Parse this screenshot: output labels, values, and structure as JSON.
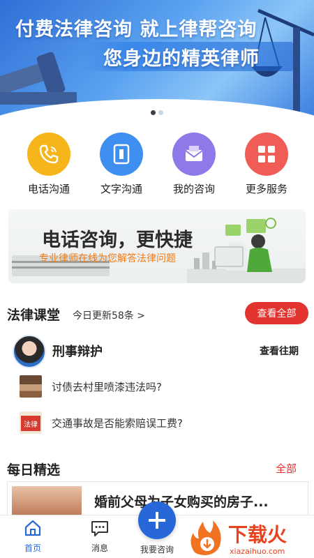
{
  "banner": {
    "line1": "付费法律咨询 就上律帮咨询",
    "line2": "您身边的精英律师",
    "dots_count": 2,
    "active_dot": 1
  },
  "actions": [
    {
      "label": "电话沟通",
      "icon": "phone-icon",
      "color": "#f7b51c"
    },
    {
      "label": "文字沟通",
      "icon": "text-chat-icon",
      "color": "#3f8ff0"
    },
    {
      "label": "我的咨询",
      "icon": "envelope-icon",
      "color": "#8f78e8"
    },
    {
      "label": "更多服务",
      "icon": "grid-icon",
      "color": "#f05c56"
    }
  ],
  "promo": {
    "title": "电话咨询，更快捷",
    "subtitle": "专业律师在线为您解答法律问题"
  },
  "classroom": {
    "title": "法律课堂",
    "update_text": "今日更新58条 >",
    "view_all": "查看全部",
    "topic": "刑事辩护",
    "history": "查看往期",
    "questions": [
      {
        "text": "讨债去村里喷漆违法吗?"
      },
      {
        "text": "交通事故是否能索赔误工费?"
      }
    ],
    "law_thumb_text": "法律"
  },
  "daily": {
    "title": "每日精选",
    "all_link": "全部",
    "article_title": "婚前父母为子女购买的房子..."
  },
  "nav": {
    "home": "首页",
    "messages": "消息",
    "consult": "我要咨询"
  },
  "watermark": {
    "text": "下载火",
    "url": "xiazaihuo.com"
  },
  "colors": {
    "primary_blue": "#2767d8",
    "accent_red": "#e3332f",
    "promo_orange": "#f07a12"
  }
}
